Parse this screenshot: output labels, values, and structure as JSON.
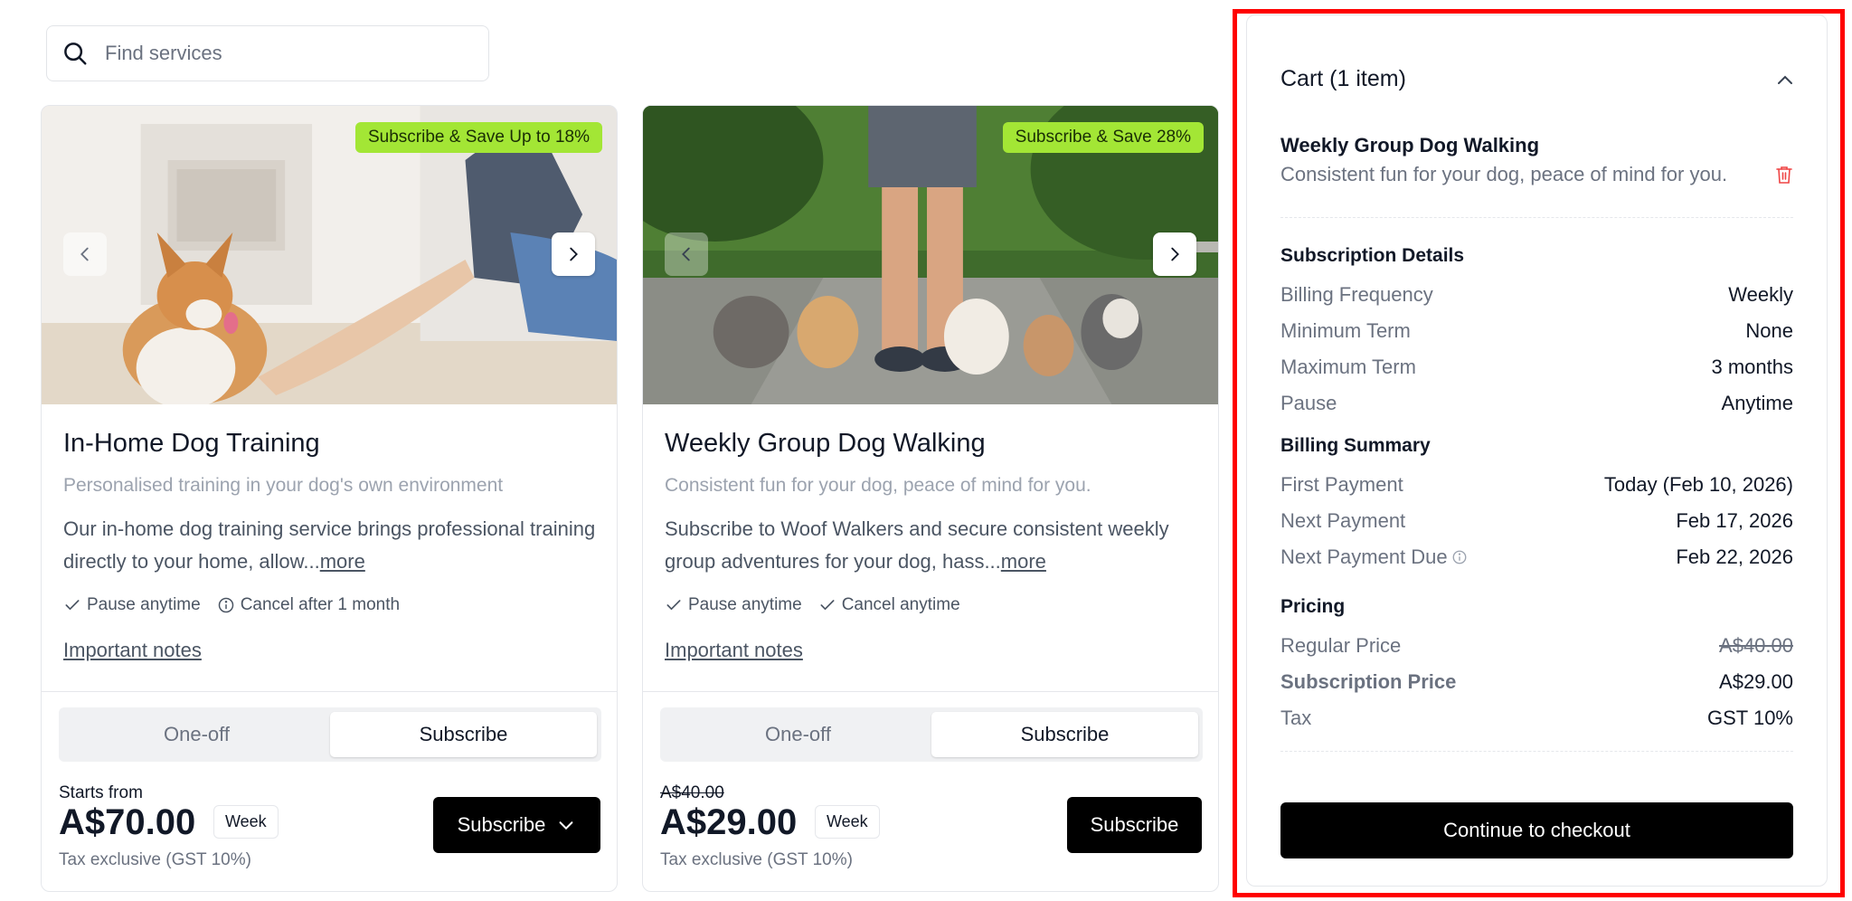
{
  "search": {
    "placeholder": "Find services"
  },
  "cards": [
    {
      "badge": "Subscribe & Save Up to 18%",
      "title": "In-Home Dog Training",
      "subtitle": "Personalised training in your dog's own environment",
      "description": "Our in-home dog training service brings professional training directly to your home, allow...",
      "more": "more",
      "features": [
        "Pause anytime",
        "Cancel after 1 month"
      ],
      "feature_icons": [
        "check-icon",
        "info-icon"
      ],
      "notes": "Important notes",
      "toggle": {
        "oneoff": "One-off",
        "subscribe": "Subscribe",
        "active": "subscribe"
      },
      "price_prefix": "Starts from",
      "price": "A$70.00",
      "period": "Week",
      "tax_note": "Tax exclusive (GST 10%)",
      "button": "Subscribe"
    },
    {
      "badge": "Subscribe & Save 28%",
      "title": "Weekly Group Dog Walking",
      "subtitle": "Consistent fun for your dog, peace of mind for you.",
      "description": "Subscribe to Woof Walkers and secure consistent weekly group adventures for your dog, hass...",
      "more": "more",
      "features": [
        "Pause anytime",
        "Cancel anytime"
      ],
      "feature_icons": [
        "check-icon",
        "check-icon"
      ],
      "notes": "Important notes",
      "toggle": {
        "oneoff": "One-off",
        "subscribe": "Subscribe",
        "active": "subscribe"
      },
      "original_price": "A$40.00",
      "price": "A$29.00",
      "period": "Week",
      "tax_note": "Tax exclusive (GST 10%)",
      "button": "Subscribe"
    }
  ],
  "cart": {
    "title": "Cart (1 item)",
    "item": {
      "name": "Weekly Group Dog Walking",
      "description": "Consistent fun for your dog, peace of mind for you."
    },
    "subscription_details": {
      "heading": "Subscription Details",
      "rows": [
        {
          "label": "Billing Frequency",
          "value": "Weekly"
        },
        {
          "label": "Minimum Term",
          "value": "None"
        },
        {
          "label": "Maximum Term",
          "value": "3 months"
        },
        {
          "label": "Pause",
          "value": "Anytime"
        }
      ]
    },
    "billing_summary": {
      "heading": "Billing Summary",
      "rows": [
        {
          "label": "First Payment",
          "value": "Today (Feb 10, 2026)"
        },
        {
          "label": "Next Payment",
          "value": "Feb 17, 2026"
        },
        {
          "label": "Next Payment Due",
          "value": "Feb 22, 2026"
        }
      ]
    },
    "pricing": {
      "heading": "Pricing",
      "rows": [
        {
          "label": "Regular Price",
          "value": "A$40.00"
        },
        {
          "label": "Subscription Price",
          "value": "A$29.00"
        },
        {
          "label": "Tax",
          "value": "GST 10%"
        }
      ]
    },
    "checkout_label": "Continue to checkout"
  },
  "colors": {
    "badge": "#a3e635",
    "primary_button": "#000000",
    "highlight_border": "#ff0000",
    "trash": "#ef4444"
  }
}
